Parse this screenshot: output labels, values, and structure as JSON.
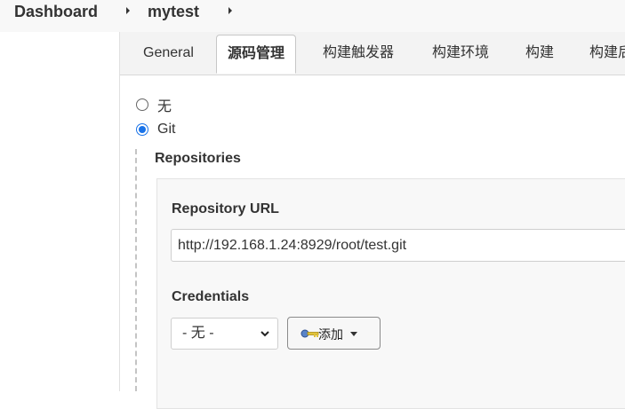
{
  "breadcrumb": {
    "items": [
      "Dashboard",
      "mytest"
    ]
  },
  "tabs": [
    {
      "label": "General",
      "active": false
    },
    {
      "label": "源码管理",
      "active": true
    },
    {
      "label": "构建触发器",
      "active": false
    },
    {
      "label": "构建环境",
      "active": false
    },
    {
      "label": "构建",
      "active": false
    },
    {
      "label": "构建后操作",
      "active": false
    }
  ],
  "scm": {
    "options": [
      {
        "label": "无",
        "selected": false
      },
      {
        "label": "Git",
        "selected": true
      }
    ],
    "repositories_label": "Repositories",
    "repository_url_label": "Repository URL",
    "repository_url_value": "http://192.168.1.24:8929/root/test.git",
    "credentials_label": "Credentials",
    "credentials_selected": "- 无 -",
    "add_button_label": "添加"
  },
  "colors": {
    "accent": "#1a73e8",
    "tab_bar_bg": "#f3f3f3",
    "panel_bg": "#f8f8f8"
  }
}
